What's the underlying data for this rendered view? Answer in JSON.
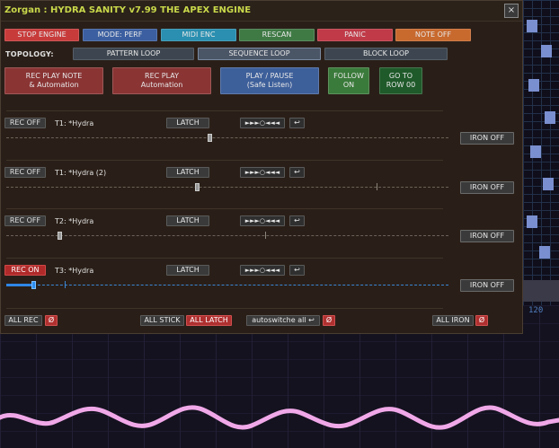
{
  "window": {
    "title": "Zorgan : HYDRA SANITY v7.99 THE APEX ENGINE",
    "close_label": "×"
  },
  "mode_buttons": [
    {
      "label": "STOP ENGINE",
      "color": "#c83b3b"
    },
    {
      "label": "MODE: PERF",
      "color": "#3b5fa0"
    },
    {
      "label": "MIDI ENC",
      "color": "#2a8fb0"
    },
    {
      "label": "RESCAN",
      "color": "#3f7a45"
    },
    {
      "label": "PANIC",
      "color": "#c03a48"
    },
    {
      "label": "NOTE OFF",
      "color": "#c8692e"
    }
  ],
  "topology": {
    "label": "TOPOLOGY:",
    "options": [
      "PATTERN LOOP",
      "SEQUENCE LOOP",
      "BLOCK LOOP"
    ],
    "selected": "SEQUENCE LOOP"
  },
  "big_buttons": [
    {
      "line1": "REC PLAY NOTE",
      "line2": "& Automation",
      "color": "#8a3434"
    },
    {
      "line1": "REC PLAY",
      "line2": "Automation",
      "color": "#8a3434"
    },
    {
      "line1": "PLAY / PAUSE",
      "line2": "(Safe Listen)",
      "color": "#3d5f9a"
    },
    {
      "line1": "FOLLOW",
      "line2": "ON",
      "color": "#3a7a3a"
    },
    {
      "line1": "GO TO",
      "line2": "ROW 00",
      "color": "#1f5a2a"
    }
  ],
  "tracks": [
    {
      "rec": "REC OFF",
      "rec_on": false,
      "name": "T1: *Hydra",
      "latch": "LATCH",
      "transport": "►►►○◄◄◄",
      "return_icon": "↩",
      "iron": "IRON OFF",
      "value": 0.46
    },
    {
      "rec": "REC OFF",
      "rec_on": false,
      "name": "T1: *Hydra (2)",
      "latch": "LATCH",
      "transport": "►►►○◄◄◄",
      "return_icon": "↩",
      "iron": "IRON OFF",
      "value": 0.43
    },
    {
      "rec": "REC OFF",
      "rec_on": false,
      "name": "T2: *Hydra",
      "latch": "LATCH",
      "transport": "►►►○◄◄◄",
      "return_icon": "↩",
      "iron": "IRON OFF",
      "value": 0.12
    },
    {
      "rec": "REC ON",
      "rec_on": true,
      "name": "T3: *Hydra",
      "latch": "LATCH",
      "transport": "►►►○◄◄◄",
      "return_icon": "↩",
      "iron": "IRON OFF",
      "value": 0.06
    }
  ],
  "footer": {
    "all_rec": "ALL REC",
    "reset": "Ø",
    "all_stick": "ALL STICK",
    "all_latch": "ALL LATCH",
    "autoswitch": "autoswitche all ↩",
    "all_iron": "ALL IRON"
  },
  "background": {
    "bottom_value": "120"
  }
}
